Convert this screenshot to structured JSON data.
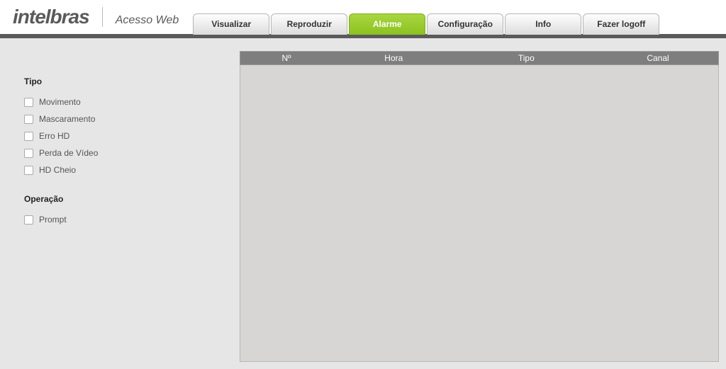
{
  "brand": {
    "name": "intelbras",
    "tagline_strong": "Acesso",
    "tagline_light": "Web"
  },
  "tabs": [
    {
      "label": "Visualizar",
      "active": false
    },
    {
      "label": "Reproduzir",
      "active": false
    },
    {
      "label": "Alarme",
      "active": true
    },
    {
      "label": "Configuração",
      "active": false
    },
    {
      "label": "Info",
      "active": false
    },
    {
      "label": "Fazer logoff",
      "active": false
    }
  ],
  "sidebar": {
    "sections": [
      {
        "title": "Tipo",
        "items": [
          {
            "label": "Movimento",
            "checked": false
          },
          {
            "label": "Mascaramento",
            "checked": false
          },
          {
            "label": "Erro HD",
            "checked": false
          },
          {
            "label": "Perda de Vídeo",
            "checked": false
          },
          {
            "label": "HD Cheio",
            "checked": false
          }
        ]
      },
      {
        "title": "Operação",
        "items": [
          {
            "label": "Prompt",
            "checked": false
          }
        ]
      }
    ]
  },
  "grid": {
    "columns": [
      "Nº",
      "Hora",
      "Tipo",
      "Canal"
    ],
    "rows": []
  }
}
